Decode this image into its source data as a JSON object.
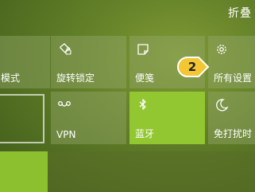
{
  "collapse_label": "折叠",
  "callout_number": "2",
  "tiles": {
    "mode": {
      "label": "模式"
    },
    "rotation_lock": {
      "label": "旋转锁定"
    },
    "notes": {
      "label": "便笺"
    },
    "all_settings": {
      "label": "所有设置"
    },
    "vpn": {
      "label": "VPN"
    },
    "bluetooth": {
      "label": "蓝牙"
    },
    "do_not_disturb": {
      "label": "免打扰时"
    }
  },
  "colors": {
    "active_tile": "#92c732",
    "badge": "#f3c633"
  }
}
